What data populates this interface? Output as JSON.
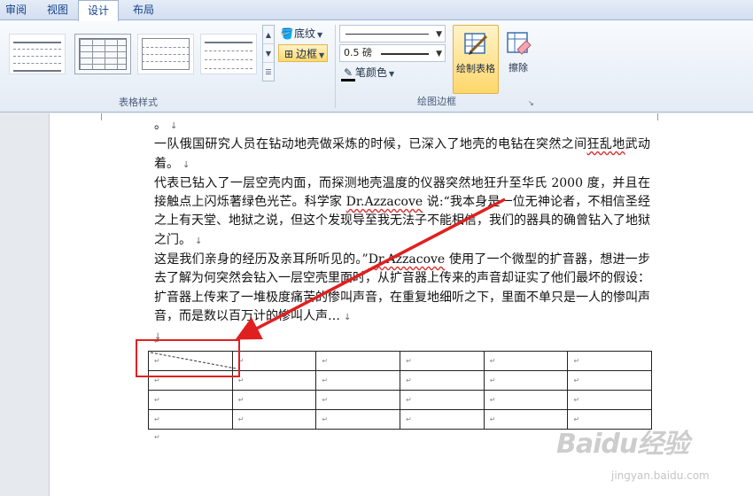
{
  "ribbon": {
    "tabs": [
      {
        "label": "审阅"
      },
      {
        "label": "视图"
      },
      {
        "label": "设计"
      },
      {
        "label": "布局"
      }
    ],
    "groups": {
      "table_styles": {
        "label": "表格样式"
      },
      "draw_borders": {
        "label": "绘图边框"
      }
    },
    "shading_label": "底纹",
    "borders_label": "边框",
    "pen_weight": "0.5 磅",
    "pen_color_label": "笔颜色",
    "draw_table_label": "绘制表格",
    "eraser_label": "擦除"
  },
  "document": {
    "top_fragment": "。",
    "para1": {
      "before": "一队俄国研究人员在钻动地壳做采炼的时候，已深入了地壳的电钻在突然之间",
      "spell": "狂乱地",
      "after": "武动着。"
    },
    "para2": {
      "part1": "代表已钻入了一层空壳内面，而探测地壳温度的仪器突然地狂升至华氏 2000 度，并且在接触点上闪烁著绿色光芒。科学家 ",
      "name": "Dr.Azzacove",
      "part2": " 说:“我本身是一位无神论者，不相信圣经之上有天堂、地狱之说，但这个发现导至我无法子不能相信，我们的器具的确曾钻入了地狱之门。"
    },
    "para3": {
      "part1": "这是我们亲身的经历及亲耳所听见的。”",
      "name": "Dr.Azzacove",
      "part2": " 使用了一个微型的扩音器，想进一步去了解为何突然会钻入一层空壳里面时，从扩音器上传来的声音却证实了他们最坏的假设：扩音器上传来了一堆极度痛苦的惨叫声音，在重复地细听之下，里面不单只是一人的惨叫声音，而是数以百万计的惨叫人声…"
    },
    "para_mark": "↓",
    "cell_mark": "↵"
  },
  "table": {
    "rows": 4,
    "cols": 6
  },
  "colors": {
    "accent_button": "#ffd96d",
    "annotation_red": "#e02020"
  },
  "watermark": {
    "brand": "Baidu经验",
    "url": "jingyan.baidu.com"
  }
}
